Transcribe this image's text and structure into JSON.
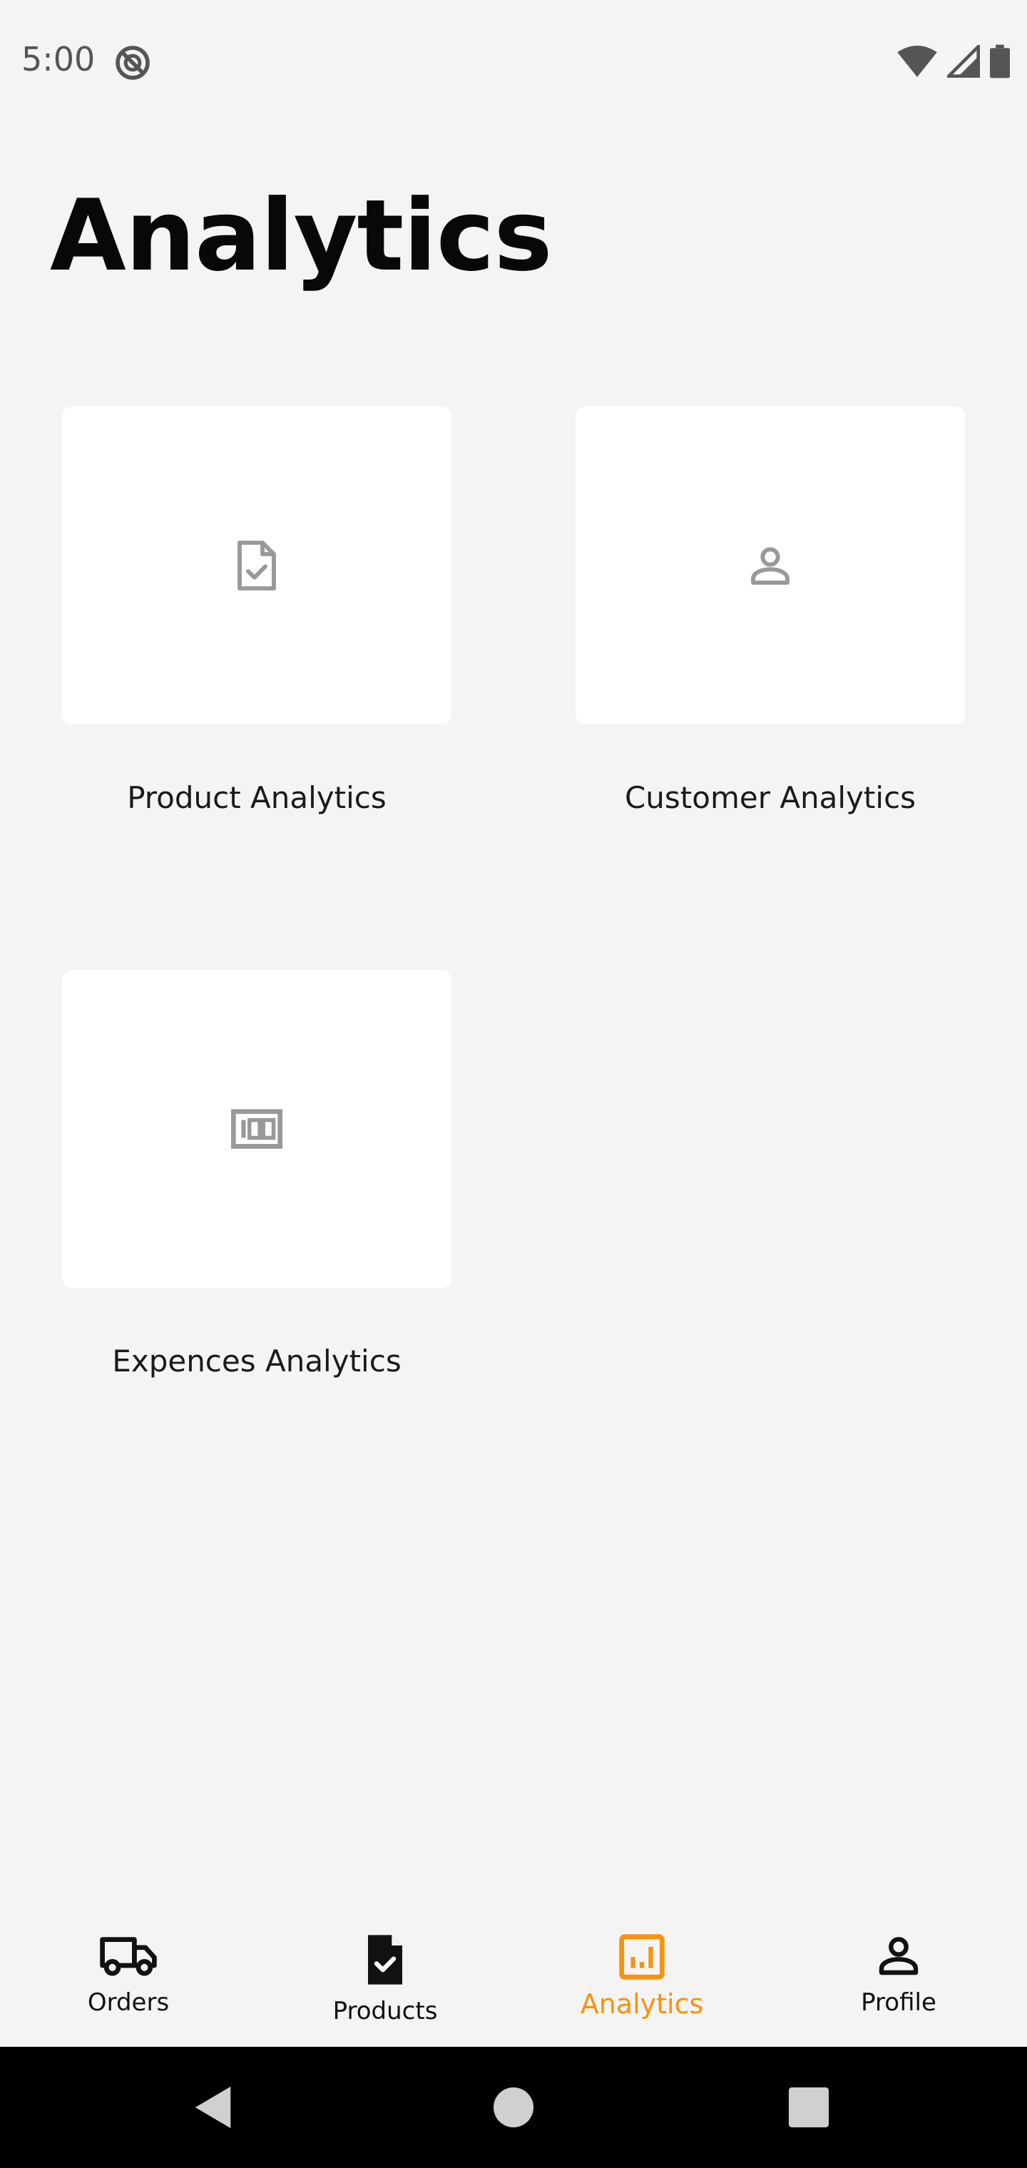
{
  "status_bar": {
    "time": "5:00"
  },
  "page": {
    "title": "Analytics"
  },
  "cards": [
    {
      "label": "Product Analytics",
      "icon": "document-check-icon"
    },
    {
      "label": "Customer Analytics",
      "icon": "person-icon"
    },
    {
      "label": "Expences Analytics",
      "icon": "money-icon"
    }
  ],
  "bottom_nav": {
    "items": [
      {
        "label": "Orders",
        "icon": "truck-icon"
      },
      {
        "label": "Products",
        "icon": "document-check-icon"
      },
      {
        "label": "Analytics",
        "icon": "chart-icon",
        "active": true
      },
      {
        "label": "Profile",
        "icon": "person-icon"
      }
    ],
    "active_color": "#f7920f"
  }
}
